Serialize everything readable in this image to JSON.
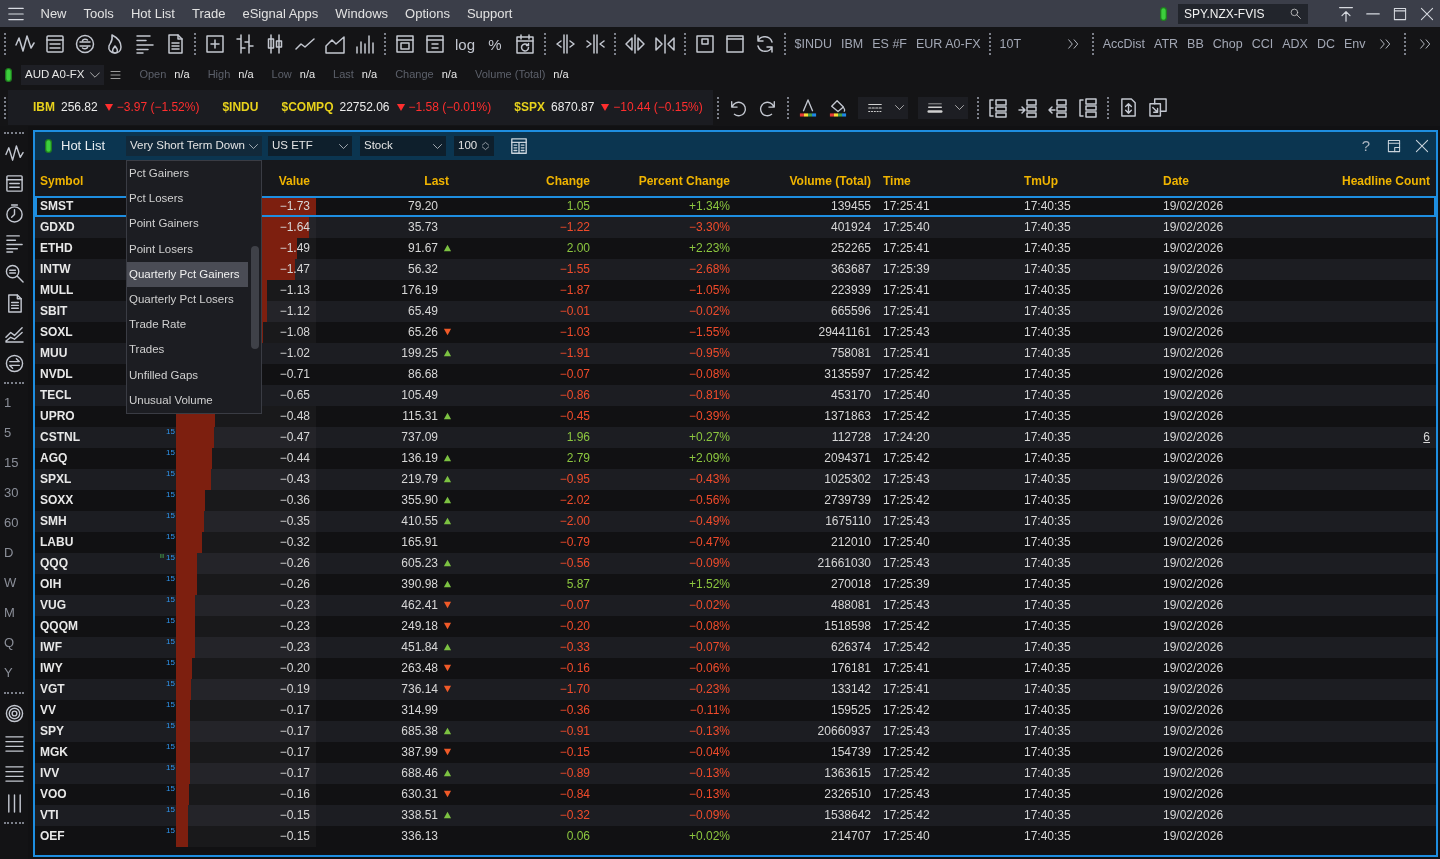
{
  "menu_bar": {
    "items": [
      "New",
      "Tools",
      "Hot List",
      "Trade",
      "eSignal Apps",
      "Windows",
      "Options",
      "Support"
    ],
    "connected": true,
    "symbol_search": {
      "value": "SPY.NZX-FVIS"
    }
  },
  "chart_toolbar": {
    "scale_buttons": [
      "log",
      "%"
    ],
    "symbols": [
      "$INDU",
      "IBM",
      "ES #F",
      "EUR A0-FX"
    ],
    "intervals": [
      "10T"
    ],
    "studies": [
      "AccDist",
      "ATR",
      "BB",
      "Chop",
      "CCI",
      "ADX",
      "DC",
      "Env"
    ]
  },
  "quote_bar": {
    "connected": true,
    "symbol": "AUD A0-FX",
    "fields": [
      {
        "label": "Open",
        "value": "n/a"
      },
      {
        "label": "High",
        "value": "n/a"
      },
      {
        "label": "Low",
        "value": "n/a"
      },
      {
        "label": "Last",
        "value": "n/a"
      },
      {
        "label": "Change",
        "value": "n/a"
      },
      {
        "label": "Volume (Total)",
        "value": "n/a"
      }
    ]
  },
  "ticker": [
    {
      "symbol": "IBM",
      "last": "256.82",
      "change": "−3.97 (−1.52%)",
      "falling": true
    },
    {
      "symbol": "$INDU"
    },
    {
      "symbol": "$COMPQ",
      "last": "22752.06",
      "change": "−1.58 (−0.01%)",
      "falling": true
    },
    {
      "symbol": "$SPX",
      "last": "6870.87",
      "change": "−10.44 (−0.15%)",
      "falling": true
    }
  ],
  "sidebar": {
    "intervals": [
      {
        "label": "1",
        "selected": false
      },
      {
        "label": "5",
        "selected": false
      },
      {
        "label": "15",
        "selected": false
      },
      {
        "label": "30",
        "selected": false
      },
      {
        "label": "60",
        "selected": false
      },
      {
        "label": "D",
        "selected": false
      },
      {
        "label": "W",
        "selected": false
      },
      {
        "label": "M",
        "selected": false
      },
      {
        "label": "Q",
        "selected": false
      },
      {
        "label": "Y",
        "selected": false
      }
    ]
  },
  "hot_list": {
    "title": "Hot List",
    "connected": true,
    "list": {
      "value": "Very Short Term Down",
      "expanded": true
    },
    "list_menu": [
      {
        "label": "Pct Gainers",
        "selected": false
      },
      {
        "label": "Pct Losers",
        "selected": false
      },
      {
        "label": "Point Gainers",
        "selected": false
      },
      {
        "label": "Point Losers",
        "selected": false
      },
      {
        "label": "Quarterly Pct Gainers",
        "selected": true
      },
      {
        "label": "Quarterly Pct Losers",
        "selected": false
      },
      {
        "label": "Trade Rate",
        "selected": false
      },
      {
        "label": "Trades",
        "selected": false
      },
      {
        "label": "Unfilled Gaps",
        "selected": false
      },
      {
        "label": "Unusual Volume",
        "selected": false
      }
    ],
    "region": "US ETF",
    "security_type": "Stock",
    "count": "100",
    "help": "?",
    "columns": [
      "Symbol",
      "Value",
      "Last",
      "Change",
      "Percent Change",
      "Volume (Total)",
      "Time",
      "TmUp",
      "Date",
      "Headline Count"
    ],
    "rows": [
      {
        "symbol": "SMST",
        "value": "−1.73",
        "level": 1.0,
        "alert": false,
        "last": "79.20",
        "tick_up": false,
        "tick_down": false,
        "change": "1.05",
        "percent_change": "+1.34%",
        "gain": true,
        "volume": "139455",
        "time": "17:25:41",
        "tmup": "17:40:35",
        "date": "19/02/2026",
        "selected": true
      },
      {
        "symbol": "GDXD",
        "value": "−1.64",
        "level": 0.948,
        "alert": false,
        "last": "35.73",
        "tick_up": false,
        "tick_down": false,
        "change": "−1.22",
        "percent_change": "−3.30%",
        "gain": false,
        "volume": "401924",
        "time": "17:25:40",
        "tmup": "17:40:35",
        "date": "19/02/2026",
        "selected": false
      },
      {
        "symbol": "ETHD",
        "value": "−1.49",
        "level": 0.861,
        "alert": false,
        "last": "91.67",
        "tick_up": true,
        "tick_down": false,
        "change": "2.00",
        "percent_change": "+2.23%",
        "gain": true,
        "volume": "252265",
        "time": "17:25:41",
        "tmup": "17:40:35",
        "date": "19/02/2026",
        "selected": false
      },
      {
        "symbol": "INTW",
        "value": "−1.47",
        "level": 0.85,
        "alert": false,
        "last": "56.32",
        "tick_up": false,
        "tick_down": false,
        "change": "−1.55",
        "percent_change": "−2.68%",
        "gain": false,
        "volume": "363687",
        "time": "17:25:39",
        "tmup": "17:40:35",
        "date": "19/02/2026",
        "selected": false
      },
      {
        "symbol": "MULL",
        "value": "−1.13",
        "level": 0.653,
        "alert": false,
        "last": "176.19",
        "tick_up": false,
        "tick_down": false,
        "change": "−1.87",
        "percent_change": "−1.05%",
        "gain": false,
        "volume": "223939",
        "time": "17:25:41",
        "tmup": "17:40:35",
        "date": "19/02/2026",
        "selected": false
      },
      {
        "symbol": "SBIT",
        "value": "−1.12",
        "level": 0.647,
        "alert": false,
        "last": "65.49",
        "tick_up": false,
        "tick_down": false,
        "change": "−0.01",
        "percent_change": "−0.02%",
        "gain": false,
        "volume": "665596",
        "time": "17:25:41",
        "tmup": "17:40:35",
        "date": "19/02/2026",
        "selected": false
      },
      {
        "symbol": "SOXL",
        "value": "−1.08",
        "level": 0.624,
        "alert": false,
        "last": "65.26",
        "tick_up": false,
        "tick_down": true,
        "change": "−1.03",
        "percent_change": "−1.55%",
        "gain": false,
        "volume": "29441161",
        "time": "17:25:43",
        "tmup": "17:40:35",
        "date": "19/02/2026",
        "selected": false
      },
      {
        "symbol": "MUU",
        "value": "−1.02",
        "alert": false,
        "last": "199.25",
        "tick_up": true,
        "tick_down": false,
        "change": "−1.91",
        "percent_change": "−0.95%",
        "gain": false,
        "volume": "758081",
        "time": "17:25:41",
        "tmup": "17:40:35",
        "date": "19/02/2026",
        "selected": false
      },
      {
        "symbol": "NVDL",
        "value": "−0.71",
        "alert": false,
        "last": "86.68",
        "tick_up": false,
        "tick_down": false,
        "change": "−0.07",
        "percent_change": "−0.08%",
        "gain": false,
        "volume": "3135597",
        "time": "17:25:42",
        "tmup": "17:40:35",
        "date": "19/02/2026",
        "selected": false
      },
      {
        "symbol": "TECL",
        "value": "−0.65",
        "alert": false,
        "last": "105.49",
        "tick_up": false,
        "tick_down": false,
        "change": "−0.86",
        "percent_change": "−0.81%",
        "gain": false,
        "volume": "453170",
        "time": "17:25:40",
        "tmup": "17:40:35",
        "date": "19/02/2026",
        "selected": false
      },
      {
        "symbol": "UPRO",
        "value": "−0.48",
        "level": 0.277,
        "alert": false,
        "last": "115.31",
        "tick_up": true,
        "tick_down": false,
        "change": "−0.45",
        "percent_change": "−0.39%",
        "gain": false,
        "volume": "1371863",
        "time": "17:25:42",
        "tmup": "17:40:35",
        "date": "19/02/2026",
        "selected": false
      },
      {
        "symbol": "CSTNL",
        "value": "−0.47",
        "level": 0.272,
        "tag": "15",
        "alert": false,
        "last": "737.09",
        "tick_up": false,
        "tick_down": false,
        "change": "1.96",
        "percent_change": "+0.27%",
        "gain": true,
        "volume": "112728",
        "time": "17:24:20",
        "tmup": "17:40:35",
        "date": "19/02/2026",
        "headline_count": "6",
        "selected": false
      },
      {
        "symbol": "AGQ",
        "value": "−0.44",
        "level": 0.254,
        "tag": "15",
        "alert": false,
        "last": "136.19",
        "tick_up": true,
        "tick_down": false,
        "change": "2.79",
        "percent_change": "+2.09%",
        "gain": true,
        "volume": "2094371",
        "time": "17:25:42",
        "tmup": "17:40:35",
        "date": "19/02/2026",
        "selected": false
      },
      {
        "symbol": "SPXL",
        "value": "−0.43",
        "level": 0.249,
        "tag": "15",
        "alert": false,
        "last": "219.79",
        "tick_up": true,
        "tick_down": false,
        "change": "−0.95",
        "percent_change": "−0.43%",
        "gain": false,
        "volume": "1025302",
        "time": "17:25:43",
        "tmup": "17:40:35",
        "date": "19/02/2026",
        "selected": false
      },
      {
        "symbol": "SOXX",
        "value": "−0.36",
        "level": 0.208,
        "tag": "15",
        "alert": false,
        "last": "355.90",
        "tick_up": true,
        "tick_down": false,
        "change": "−2.02",
        "percent_change": "−0.56%",
        "gain": false,
        "volume": "2739739",
        "time": "17:25:42",
        "tmup": "17:40:35",
        "date": "19/02/2026",
        "selected": false
      },
      {
        "symbol": "SMH",
        "value": "−0.35",
        "level": 0.202,
        "tag": "15",
        "alert": false,
        "last": "410.55",
        "tick_up": true,
        "tick_down": false,
        "change": "−2.00",
        "percent_change": "−0.49%",
        "gain": false,
        "volume": "1675110",
        "time": "17:25:43",
        "tmup": "17:40:35",
        "date": "19/02/2026",
        "selected": false
      },
      {
        "symbol": "LABU",
        "value": "−0.32",
        "level": 0.185,
        "tag": "15",
        "alert": false,
        "last": "165.91",
        "tick_up": false,
        "tick_down": false,
        "change": "−0.79",
        "percent_change": "−0.47%",
        "gain": false,
        "volume": "212010",
        "time": "17:25:40",
        "tmup": "17:40:35",
        "date": "19/02/2026",
        "selected": false
      },
      {
        "symbol": "QQQ",
        "value": "−0.26",
        "level": 0.15,
        "tag": "15",
        "alert": true,
        "last": "605.23",
        "tick_up": true,
        "tick_down": false,
        "change": "−0.56",
        "percent_change": "−0.09%",
        "gain": false,
        "volume": "21661030",
        "time": "17:25:43",
        "tmup": "17:40:35",
        "date": "19/02/2026",
        "selected": false
      },
      {
        "symbol": "OIH",
        "value": "−0.26",
        "level": 0.15,
        "tag": "15",
        "alert": false,
        "last": "390.98",
        "tick_up": true,
        "tick_down": false,
        "change": "5.87",
        "percent_change": "+1.52%",
        "gain": true,
        "volume": "270018",
        "time": "17:25:39",
        "tmup": "17:40:35",
        "date": "19/02/2026",
        "selected": false
      },
      {
        "symbol": "VUG",
        "value": "−0.23",
        "level": 0.133,
        "tag": "15",
        "alert": false,
        "last": "462.41",
        "tick_up": false,
        "tick_down": true,
        "change": "−0.07",
        "percent_change": "−0.02%",
        "gain": false,
        "volume": "488081",
        "time": "17:25:43",
        "tmup": "17:40:35",
        "date": "19/02/2026",
        "selected": false
      },
      {
        "symbol": "QQQM",
        "value": "−0.23",
        "level": 0.133,
        "tag": "15",
        "alert": false,
        "last": "249.18",
        "tick_up": false,
        "tick_down": true,
        "change": "−0.20",
        "percent_change": "−0.08%",
        "gain": false,
        "volume": "1518598",
        "time": "17:25:42",
        "tmup": "17:40:35",
        "date": "19/02/2026",
        "selected": false
      },
      {
        "symbol": "IWF",
        "value": "−0.23",
        "level": 0.133,
        "tag": "15",
        "alert": false,
        "last": "451.84",
        "tick_up": true,
        "tick_down": false,
        "change": "−0.33",
        "percent_change": "−0.07%",
        "gain": false,
        "volume": "626374",
        "time": "17:25:42",
        "tmup": "17:40:35",
        "date": "19/02/2026",
        "selected": false
      },
      {
        "symbol": "IWY",
        "value": "−0.20",
        "level": 0.116,
        "tag": "15",
        "alert": false,
        "last": "263.48",
        "tick_up": false,
        "tick_down": true,
        "change": "−0.16",
        "percent_change": "−0.06%",
        "gain": false,
        "volume": "176181",
        "time": "17:25:41",
        "tmup": "17:40:35",
        "date": "19/02/2026",
        "selected": false
      },
      {
        "symbol": "VGT",
        "value": "−0.19",
        "level": 0.11,
        "tag": "15",
        "alert": false,
        "last": "736.14",
        "tick_up": false,
        "tick_down": true,
        "change": "−1.70",
        "percent_change": "−0.23%",
        "gain": false,
        "volume": "133142",
        "time": "17:25:41",
        "tmup": "17:40:35",
        "date": "19/02/2026",
        "selected": false
      },
      {
        "symbol": "VV",
        "value": "−0.17",
        "level": 0.098,
        "tag": "15",
        "alert": false,
        "last": "314.99",
        "tick_up": false,
        "tick_down": false,
        "change": "−0.36",
        "percent_change": "−0.11%",
        "gain": false,
        "volume": "159525",
        "time": "17:25:42",
        "tmup": "17:40:35",
        "date": "19/02/2026",
        "selected": false
      },
      {
        "symbol": "SPY",
        "value": "−0.17",
        "level": 0.098,
        "tag": "15",
        "alert": false,
        "last": "685.38",
        "tick_up": true,
        "tick_down": false,
        "change": "−0.91",
        "percent_change": "−0.13%",
        "gain": false,
        "volume": "20660937",
        "time": "17:25:43",
        "tmup": "17:40:35",
        "date": "19/02/2026",
        "selected": false
      },
      {
        "symbol": "MGK",
        "value": "−0.17",
        "level": 0.098,
        "tag": "15",
        "alert": false,
        "last": "387.99",
        "tick_up": false,
        "tick_down": true,
        "change": "−0.15",
        "percent_change": "−0.04%",
        "gain": false,
        "volume": "154739",
        "time": "17:25:42",
        "tmup": "17:40:35",
        "date": "19/02/2026",
        "selected": false
      },
      {
        "symbol": "IVV",
        "value": "−0.17",
        "level": 0.098,
        "tag": "15",
        "alert": false,
        "last": "688.46",
        "tick_up": true,
        "tick_down": false,
        "change": "−0.89",
        "percent_change": "−0.13%",
        "gain": false,
        "volume": "1363615",
        "time": "17:25:42",
        "tmup": "17:40:35",
        "date": "19/02/2026",
        "selected": false
      },
      {
        "symbol": "VOO",
        "value": "−0.16",
        "level": 0.092,
        "tag": "15",
        "alert": false,
        "last": "630.31",
        "tick_up": false,
        "tick_down": true,
        "change": "−0.84",
        "percent_change": "−0.13%",
        "gain": false,
        "volume": "2326510",
        "time": "17:25:43",
        "tmup": "17:40:35",
        "date": "19/02/2026",
        "selected": false
      },
      {
        "symbol": "VTI",
        "value": "−0.15",
        "level": 0.087,
        "tag": "15",
        "alert": false,
        "last": "338.51",
        "tick_up": true,
        "tick_down": false,
        "change": "−0.32",
        "percent_change": "−0.09%",
        "gain": false,
        "volume": "1538642",
        "time": "17:25:42",
        "tmup": "17:40:35",
        "date": "19/02/2026",
        "selected": false
      },
      {
        "symbol": "OEF",
        "value": "−0.15",
        "level": 0.087,
        "tag": "15",
        "alert": false,
        "last": "336.13",
        "tick_up": false,
        "tick_down": false,
        "change": "0.06",
        "percent_change": "+0.02%",
        "gain": true,
        "volume": "214707",
        "time": "17:25:40",
        "tmup": "17:40:35",
        "date": "19/02/2026",
        "selected": false
      }
    ]
  }
}
